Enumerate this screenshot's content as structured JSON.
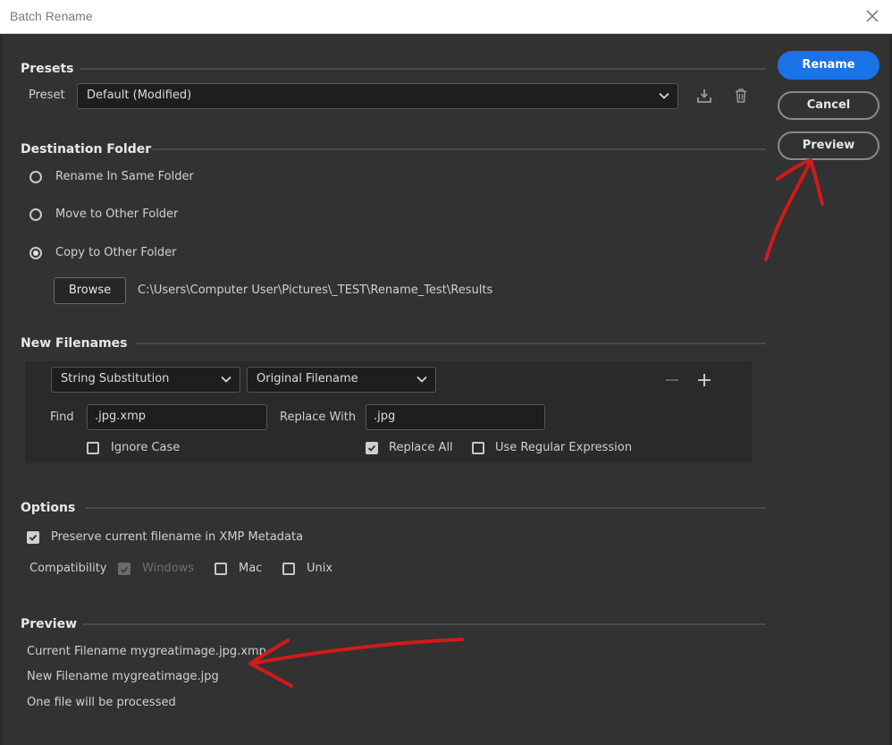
{
  "window": {
    "title": "Batch Rename"
  },
  "buttons": {
    "rename": "Rename",
    "cancel": "Cancel",
    "preview": "Preview"
  },
  "presets": {
    "section_title": "Presets",
    "preset_label": "Preset",
    "preset_value": "Default (Modified)"
  },
  "destination": {
    "section_title": "Destination Folder",
    "options": [
      "Rename In Same Folder",
      "Move to Other Folder",
      "Copy to Other Folder"
    ],
    "selected_index": 2,
    "browse_label": "Browse",
    "path": "C:\\Users\\Computer User\\Pictures\\_TEST\\Rename_Test\\Results"
  },
  "new_filenames": {
    "section_title": "New Filenames",
    "type_value": "String Substitution",
    "source_value": "Original Filename",
    "find_label": "Find",
    "find_value": ".jpg.xmp",
    "replace_label": "Replace With",
    "replace_value": ".jpg",
    "ignore_case_label": "Ignore Case",
    "ignore_case_checked": false,
    "replace_all_label": "Replace All",
    "replace_all_checked": true,
    "regex_label": "Use Regular Expression",
    "regex_checked": false
  },
  "options": {
    "section_title": "Options",
    "preserve_label": "Preserve current filename in XMP Metadata",
    "preserve_checked": true,
    "compat_label": "Compatibility",
    "windows_label": "Windows",
    "mac_label": "Mac",
    "unix_label": "Unix"
  },
  "preview": {
    "section_title": "Preview",
    "current_filename": "Current Filename mygreatimage.jpg.xmp",
    "new_filename": "New Filename mygreatimage.jpg",
    "summary": "One file will be processed"
  },
  "colors": {
    "accent": "#1a73e8",
    "annotation": "#d11a1a",
    "background": "#323232"
  },
  "icons": [
    "close-icon",
    "save-preset-icon",
    "trash-icon",
    "chevron-down-icon",
    "minus-icon",
    "plus-icon",
    "checkmark-icon"
  ]
}
